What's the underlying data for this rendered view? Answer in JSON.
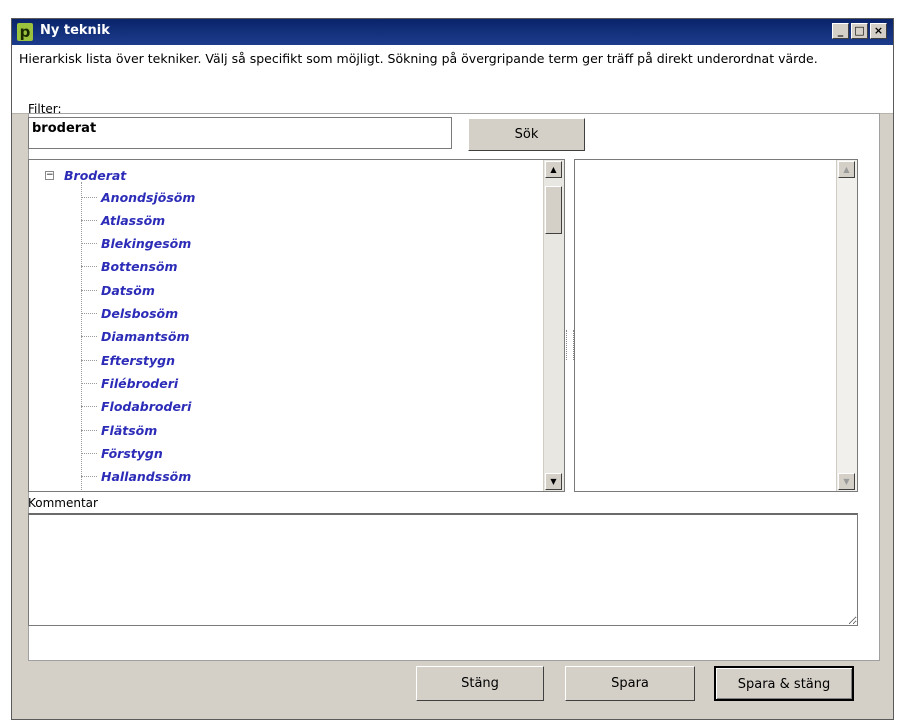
{
  "window": {
    "title": "Ny teknik",
    "logo_letter": "p",
    "description": "Hierarkisk lista över tekniker.  Välj så specifikt som möjligt. Sökning på övergripande term ger träff på direkt underordnat värde."
  },
  "filter": {
    "label": "Filter:",
    "value": "broderat",
    "search_button": "Sök"
  },
  "tree": {
    "root": "Broderat",
    "toggle": "−",
    "items": [
      "Anondsjösöm",
      "Atlassöm",
      "Blekingesöm",
      "Bottensöm",
      "Datsöm",
      "Delsbosöm",
      "Diamantsöm",
      "Efterstygn",
      "Filébroderi",
      "Flodabroderi",
      "Flätsöm",
      "Förstygn",
      "Hallandssöm"
    ]
  },
  "comment": {
    "label": "Kommentar",
    "value": ""
  },
  "buttons": {
    "close": "Stäng",
    "save": "Spara",
    "save_close": "Spara & stäng"
  },
  "colors": {
    "titlebar": "#0a246a",
    "tree_text": "#2c2cb8",
    "logo": "#9bc23c"
  }
}
